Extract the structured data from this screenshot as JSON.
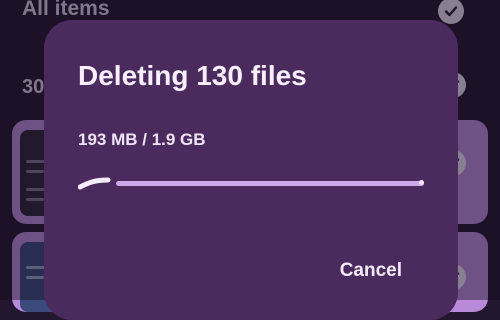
{
  "background": {
    "section_title": "All items",
    "date_label": "30",
    "check_icon": "check-icon",
    "accent_card": "#b98ad9"
  },
  "dialog": {
    "title": "Deleting 130 files",
    "progress_text": "193 MB / 1.9 GB",
    "progress_fraction": 0.1,
    "cancel_label": "Cancel",
    "surface_color": "#4b2b5e",
    "progress_color": "#cfa8ec"
  }
}
